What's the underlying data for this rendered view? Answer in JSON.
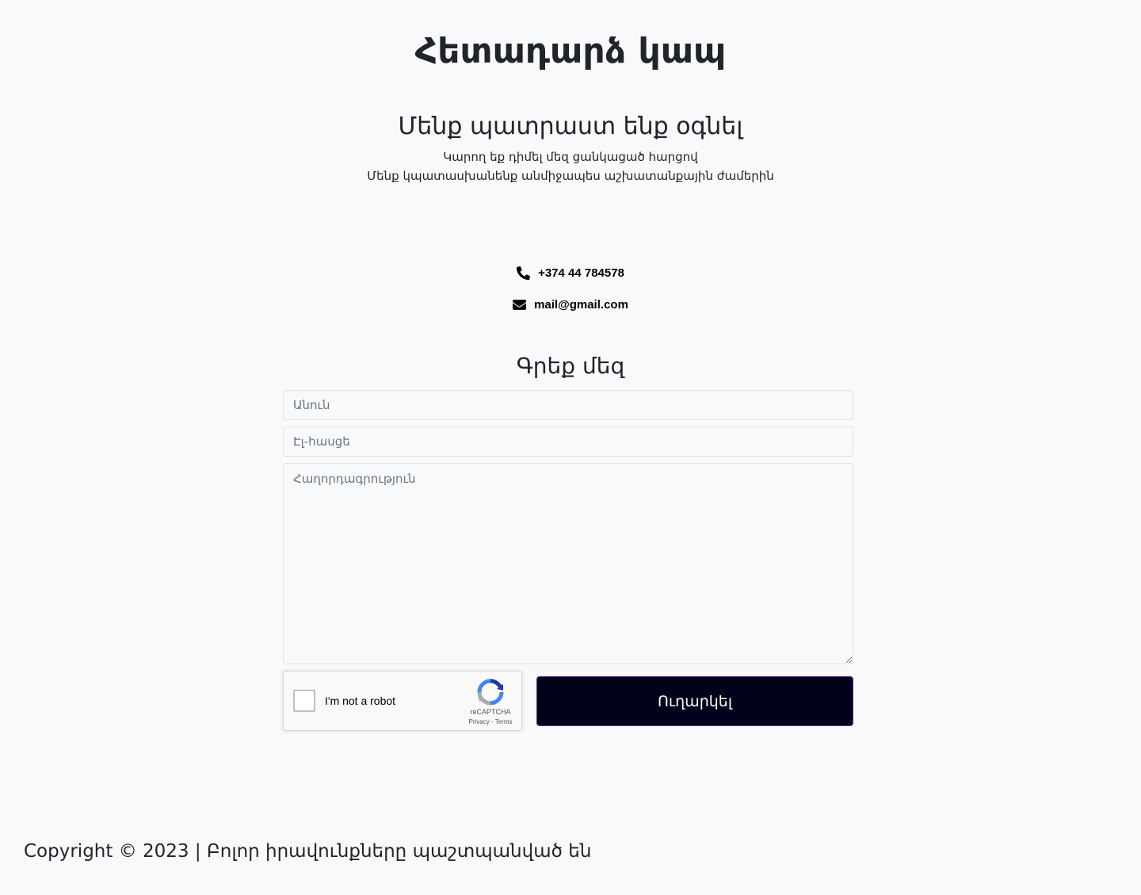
{
  "header": {
    "title": "Հետադարձ կապ",
    "subtitle": "Մենք պատրաստ ենք օգնել",
    "description_line1": "Կարող եք դիմել մեզ ցանկացած հարցով",
    "description_line2": "Մենք կպատասխանենք անմիջապես աշխատանքային ժամերին"
  },
  "contact": {
    "phone": "+374 44 784578",
    "phone_icon": "phone-icon",
    "email": "mail@gmail.com",
    "email_icon": "envelope-icon"
  },
  "form": {
    "title": "Գրեք մեզ",
    "name_placeholder": "Անուն",
    "email_placeholder": "Էլ-հասցե",
    "message_placeholder": "Հաղորդագրություն",
    "submit_label": "Ուղարկել"
  },
  "recaptcha": {
    "label": "I'm not a robot",
    "brand": "reCAPTCHA",
    "privacy": "Privacy",
    "separator": " - ",
    "terms": "Terms"
  },
  "footer": {
    "copyright": "Copyright © 2023 | Բոլոր իրավունքները պաշտպանված  են"
  },
  "colors": {
    "background": "#f8f9fa",
    "submit_bg": "#02021a",
    "submit_border": "#5b2a9c"
  }
}
